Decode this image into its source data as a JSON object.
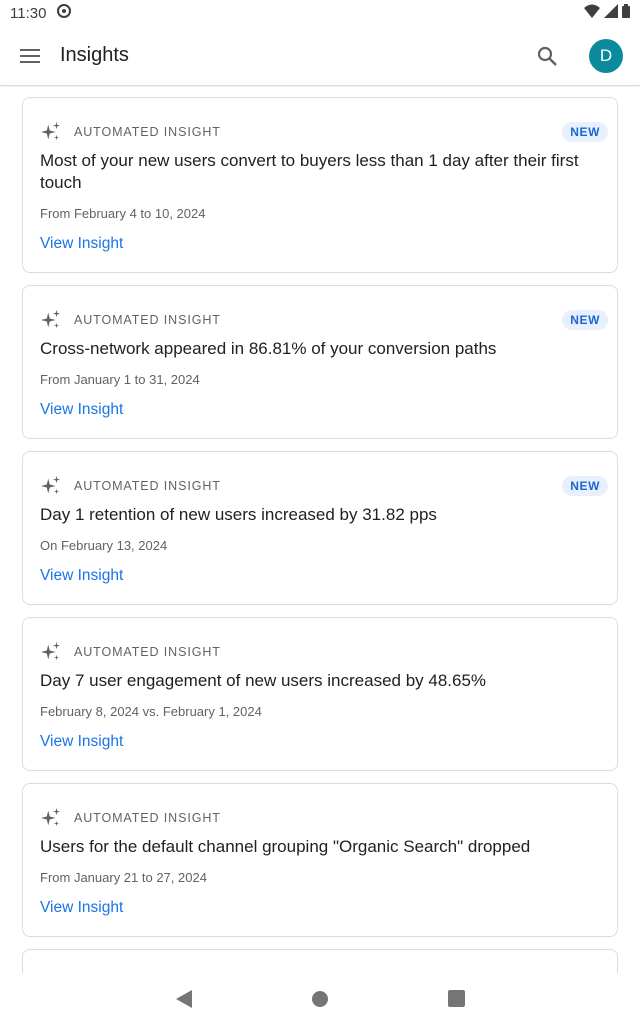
{
  "status_bar": {
    "time": "11:30"
  },
  "app_bar": {
    "title": "Insights",
    "avatar_letter": "D",
    "avatar_color": "#0b8a9e"
  },
  "insights": [
    {
      "kicker": "AUTOMATED INSIGHT",
      "badge": "NEW",
      "title": "Most of your new users convert to buyers less than 1 day after their first touch",
      "date": "From February 4 to 10, 2024",
      "link": "View Insight"
    },
    {
      "kicker": "AUTOMATED INSIGHT",
      "badge": "NEW",
      "title": "Cross-network appeared in 86.81% of your conversion paths",
      "date": "From January 1 to 31, 2024",
      "link": "View Insight"
    },
    {
      "kicker": "AUTOMATED INSIGHT",
      "badge": "NEW",
      "title": "Day 1 retention of new users increased by 31.82 pps",
      "date": "On February 13, 2024",
      "link": "View Insight"
    },
    {
      "kicker": "AUTOMATED INSIGHT",
      "title": "Day 7 user engagement of new users increased by 48.65%",
      "date": "February 8, 2024 vs. February 1, 2024",
      "link": "View Insight"
    },
    {
      "kicker": "AUTOMATED INSIGHT",
      "title": "Users for the default channel grouping \"Organic Search\" dropped",
      "date": "From January 21 to 27, 2024",
      "link": "View Insight"
    }
  ],
  "colors": {
    "accent": "#1a73e8",
    "badge_bg": "#e8f0fe",
    "badge_text": "#1967d2"
  }
}
